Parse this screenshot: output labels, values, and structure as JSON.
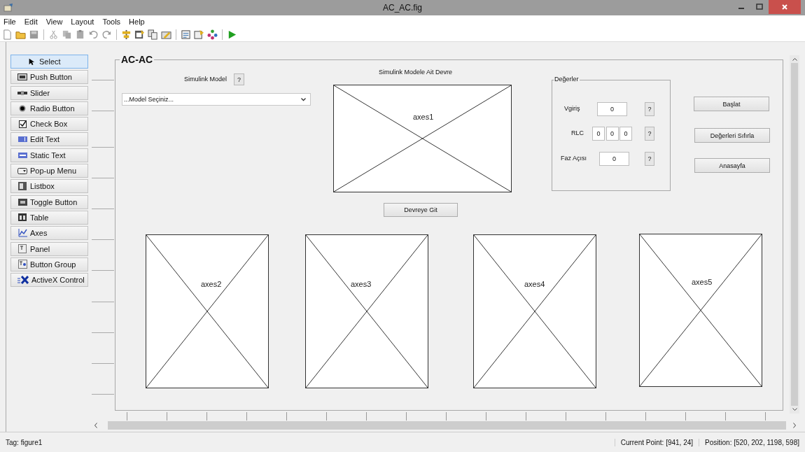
{
  "window": {
    "title": "AC_AC.fig"
  },
  "menu": [
    "File",
    "Edit",
    "View",
    "Layout",
    "Tools",
    "Help"
  ],
  "palette": [
    {
      "label": "Select",
      "selected": true
    },
    {
      "label": "Push Button",
      "selected": false
    },
    {
      "label": "Slider",
      "selected": false
    },
    {
      "label": "Radio Button",
      "selected": false
    },
    {
      "label": "Check Box",
      "selected": false
    },
    {
      "label": "Edit Text",
      "selected": false
    },
    {
      "label": "Static Text",
      "selected": false
    },
    {
      "label": "Pop-up Menu",
      "selected": false
    },
    {
      "label": "Listbox",
      "selected": false
    },
    {
      "label": "Toggle Button",
      "selected": false
    },
    {
      "label": "Table",
      "selected": false
    },
    {
      "label": "Axes",
      "selected": false
    },
    {
      "label": "Panel",
      "selected": false
    },
    {
      "label": "Button Group",
      "selected": false
    },
    {
      "label": "ActiveX Control",
      "selected": false
    }
  ],
  "main_panel": {
    "title": "AC-AC",
    "model_label": "Simulink Model",
    "model_help": "?",
    "model_popup": "...Model Seçiniz...",
    "circuit_label": "Simulink Modele Ait Devre",
    "axes": [
      {
        "label": "axes1"
      },
      {
        "label": "axes2"
      },
      {
        "label": "axes3"
      },
      {
        "label": "axes4"
      },
      {
        "label": "axes5"
      }
    ],
    "go_button": "Devreye Git",
    "values_panel": {
      "title": "Değerler",
      "rows": [
        {
          "label": "Vgiriş",
          "fields": [
            "0"
          ],
          "help": "?"
        },
        {
          "label": "RLC",
          "fields": [
            "0",
            "0",
            "0"
          ],
          "help": "?"
        },
        {
          "label": "Faz Açısı",
          "fields": [
            "0"
          ],
          "help": "?"
        }
      ]
    },
    "buttons": [
      "Başlat",
      "Değerleri Sıfırla",
      "Anasayfa"
    ]
  },
  "status_bar": {
    "tag": "Tag: figure1",
    "current_point": "Current Point:  [941, 24]",
    "position": "Position: [520, 202, 1198, 598]"
  }
}
